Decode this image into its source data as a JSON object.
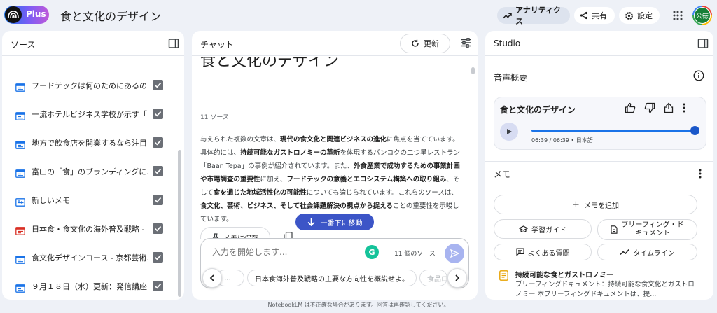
{
  "app": {
    "logo_text": "Plus",
    "title": "食と文化のデザイン"
  },
  "header": {
    "analytics_label": "アナリティクス",
    "share_label": "共有",
    "settings_label": "設定",
    "avatar_text": "公徳"
  },
  "sources": {
    "title": "ソース",
    "items": [
      {
        "label": "フードテックは何のためにあるの...",
        "type": "web",
        "checked": true
      },
      {
        "label": "一流ホテルビジネス学校が示す「...",
        "type": "web",
        "checked": true
      },
      {
        "label": "地方で飲食店を開業するなら注目...",
        "type": "web",
        "checked": true
      },
      {
        "label": "富山の「食」のブランディングに...",
        "type": "web",
        "checked": true
      },
      {
        "label": "新しいメモ",
        "type": "note",
        "checked": true
      },
      {
        "label": "日本食・食文化の海外普及戦略 - ...",
        "type": "pdf",
        "checked": true
      },
      {
        "label": "食文化デザインコース - 京都芸術...",
        "type": "web",
        "checked": true
      },
      {
        "label": "９月１８日（水）更新：発信講座...",
        "type": "web",
        "checked": true
      }
    ]
  },
  "chat": {
    "title": "チャット",
    "refresh_label": "更新",
    "heading": "食と文化のデザイン",
    "source_count": "11 ソース",
    "summary": [
      {
        "t": "与えられた複数の文章は、",
        "b": false
      },
      {
        "t": "現代の食文化と関連ビジネスの進化",
        "b": true
      },
      {
        "t": "に焦点を当てています。具体的には、",
        "b": false
      },
      {
        "t": "持続可能なガストロノミーの革新",
        "b": true
      },
      {
        "t": "を体現するバンコクの二つ星レストラン「Baan Tepa」の事例が紹介されています。また、",
        "b": false
      },
      {
        "t": "外食産業で成功するための事業計画や市場調査の重要性",
        "b": true
      },
      {
        "t": "に加え、",
        "b": false
      },
      {
        "t": "フードテックの意義とエコシステム構築への取り組み",
        "b": true
      },
      {
        "t": "、そして",
        "b": false
      },
      {
        "t": "食を通じた地域活性化の可能性",
        "b": true
      },
      {
        "t": "についても論じられています。これらのソースは、",
        "b": false
      },
      {
        "t": "食文化、芸術、ビジネス、そして社会課題解決の視点から捉える",
        "b": true
      },
      {
        "t": "ことの重要性を示唆しています。",
        "b": false
      }
    ],
    "save_note_label": "メモに保存",
    "jump_label": "一番下に移動",
    "input_placeholder": "入力を開始します...",
    "grammarly_letter": "G",
    "sources_count_label": "11 個のソース",
    "suggestions": [
      "日本食海外普及戦略の主要な方向性を概説せよ。",
      "食品ロ"
    ],
    "suggestion_prev": "…"
  },
  "studio": {
    "title": "Studio",
    "audio_overview_title": "音声概要",
    "audio": {
      "name": "食と文化のデザイン",
      "meta": "06:39 / 06:39 • 日本語",
      "progress": 1.0
    },
    "memo_title": "メモ",
    "add_memo_label": "メモを追加",
    "buttons": {
      "study_guide": "学習ガイド",
      "briefing_line1": "ブリーフィング・ド",
      "briefing_line2": "キュメント",
      "faq": "よくある質問",
      "timeline": "タイムライン"
    },
    "note": {
      "title": "持続可能な食とガストロノミー",
      "desc": "ブリーフィングドキュメント：持続可能な食文化とガストロノミー 本ブリーフィングドキュメントは、提..."
    }
  },
  "footer": "NotebookLM は不正確な場合があります。回答は再確認してください。",
  "colors": {
    "accent": "#1a73e8",
    "jump_button": "#3c55c7",
    "send_button": "#a8b4f0"
  }
}
